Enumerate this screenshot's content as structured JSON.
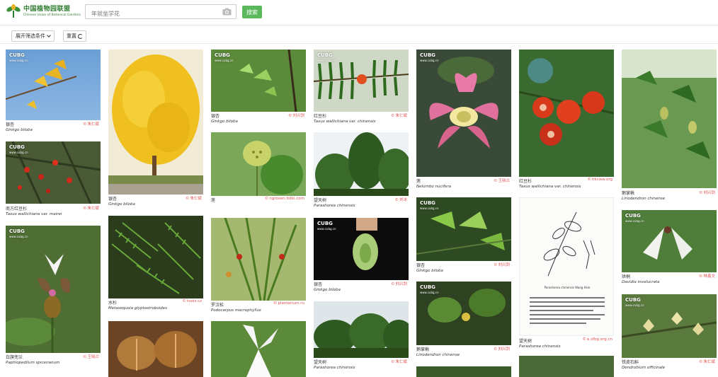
{
  "header": {
    "logo_cn": "中国植物园联盟",
    "logo_en": "Chinese Union of Botanical Gardens",
    "search_placeholder": "年就坐学花",
    "search_button": "搜索"
  },
  "toolbar": {
    "filter_label": "展开筛选条件",
    "reset_label": "重置"
  },
  "watermark": {
    "brand": "CUBG",
    "site": "www.cubg.cn"
  },
  "cards": [
    {
      "cn": "银杏",
      "lat": "Ginkgo biloba",
      "author": "朱仁斌"
    },
    {
      "cn": "南方红豆杉",
      "lat": "Taxus wallichiana var. mairei",
      "author": "朱仁斌"
    },
    {
      "cn": "白旗兜兰",
      "lat": "Paphiopedilum spicerianum",
      "author": "王晓兰"
    },
    {
      "cn": "银杏",
      "lat": "Ginkgo biloba",
      "author": "朱仁斌"
    },
    {
      "cn": "水杉",
      "lat": "Metasequoia glyptostroboides",
      "author": "tools.cz"
    },
    {
      "cn": "银杏",
      "lat": "Ginkgo biloba",
      "author": "刘兴剑"
    },
    {
      "cn": "莲",
      "lat": "Nelumbo nucifera",
      "author": "ngrosen.fotki.com"
    },
    {
      "cn": "罗汉松",
      "lat": "Podocarpus macrophyllus",
      "author": "plantarium.ru"
    },
    {
      "cn": "红豆杉",
      "lat": "Taxus wallichiana var. chinensis",
      "author": "朱仁斌"
    },
    {
      "cn": "望天树",
      "lat": "Parashorea chinensis",
      "author": "刘冰"
    },
    {
      "cn": "银杏",
      "lat": "Ginkgo biloba",
      "author": "刘兴剑"
    },
    {
      "cn": "望天树",
      "lat": "Parashorea chinensis",
      "author": "朱仁斌"
    },
    {
      "cn": "莲",
      "lat": "Nelumbo nucifera",
      "author": "王晓兰"
    },
    {
      "cn": "银杏",
      "lat": "Ginkgo biloba",
      "author": "刘兴剑"
    },
    {
      "cn": "鹅掌楸",
      "lat": "Liriodendron chinense",
      "author": "刘兴剑"
    },
    {
      "cn": "红豆杉",
      "lat": "Taxus wallichiana var. chinensis",
      "author": "hkcww.org"
    },
    {
      "cn": "望天树",
      "lat": "Parashorea chinensis",
      "author": "e.sfbg.org.cn"
    },
    {
      "cn": "鹅掌楸",
      "lat": "Liriodendron chinense",
      "author": "刘兴剑"
    },
    {
      "cn": "珙桐",
      "lat": "Davidia involucrata",
      "author": "林鑫文"
    },
    {
      "cn": "铁皮石斛",
      "lat": "Dendrobium officinale",
      "author": "朱仁斌"
    }
  ],
  "illustration_caption": "Parashorea chinensis Wang Hsie"
}
